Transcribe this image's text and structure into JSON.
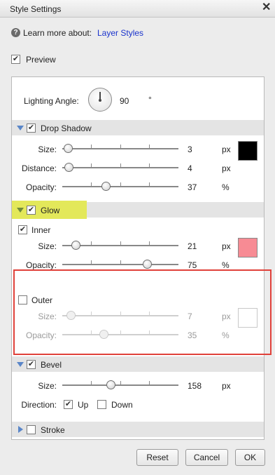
{
  "window": {
    "title": "Style Settings"
  },
  "help": {
    "learn_text": "Learn more about:",
    "link_label": "Layer Styles"
  },
  "preview": {
    "label": "Preview",
    "checked": true
  },
  "lighting": {
    "label": "Lighting Angle:",
    "value": "90",
    "unit": "°"
  },
  "drop_shadow": {
    "title": "Drop Shadow",
    "checked": true,
    "size": {
      "label": "Size:",
      "value": "3",
      "unit": "px"
    },
    "distance": {
      "label": "Distance:",
      "value": "4",
      "unit": "px"
    },
    "opacity": {
      "label": "Opacity:",
      "value": "37",
      "unit": "%"
    },
    "color": "#000000"
  },
  "glow": {
    "title": "Glow",
    "checked": true,
    "inner": {
      "label": "Inner",
      "checked": true,
      "size": {
        "label": "Size:",
        "value": "21",
        "unit": "px"
      },
      "opacity": {
        "label": "Opacity:",
        "value": "75",
        "unit": "%"
      },
      "color": "#f78b94"
    },
    "outer": {
      "label": "Outer",
      "checked": false,
      "size": {
        "label": "Size:",
        "value": "7",
        "unit": "px"
      },
      "opacity": {
        "label": "Opacity:",
        "value": "35",
        "unit": "%"
      },
      "color": "#ffffff"
    }
  },
  "bevel": {
    "title": "Bevel",
    "checked": true,
    "size": {
      "label": "Size:",
      "value": "158",
      "unit": "px"
    },
    "direction": {
      "label": "Direction:",
      "up": "Up",
      "up_checked": true,
      "down": "Down",
      "down_checked": false
    }
  },
  "stroke": {
    "title": "Stroke",
    "checked": false
  },
  "buttons": {
    "reset": "Reset",
    "cancel": "Cancel",
    "ok": "OK"
  },
  "colors": {
    "highlight": "#e3e85a",
    "annotation_red": "#e0413a",
    "section_arrow": "#5a86c8"
  }
}
